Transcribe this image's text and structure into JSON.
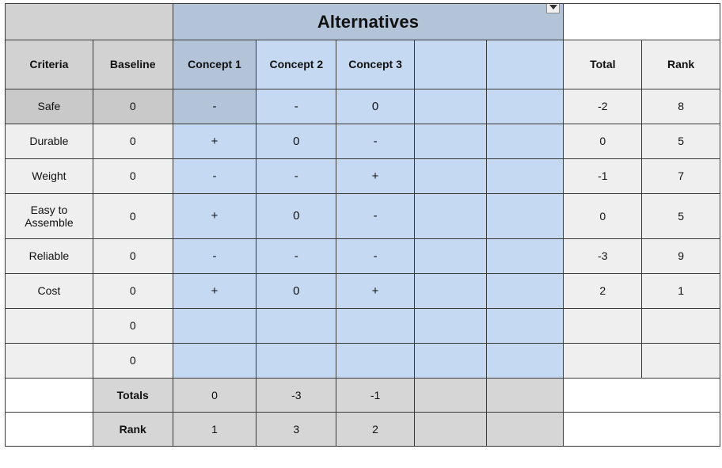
{
  "document": {
    "kind": "pugh-decision-matrix"
  },
  "band": {
    "alternatives_label": "Alternatives",
    "dropdown_icon": "chevron-down-icon"
  },
  "headers": {
    "criteria": "Criteria",
    "baseline": "Baseline",
    "alt1": "Concept 1",
    "alt2": "Concept 2",
    "alt3": "Concept 3",
    "alt4": "",
    "alt5": "",
    "total": "Total",
    "rank": "Rank"
  },
  "rows": [
    {
      "criteria": "Safe",
      "baseline": "0",
      "a1": "-",
      "a2": "-",
      "a3": "0",
      "a4": "",
      "a5": "",
      "total": "-2",
      "rank": "8"
    },
    {
      "criteria": "Durable",
      "baseline": "0",
      "a1": "+",
      "a2": "0",
      "a3": "-",
      "a4": "",
      "a5": "",
      "total": "0",
      "rank": "5"
    },
    {
      "criteria": "Weight",
      "baseline": "0",
      "a1": "-",
      "a2": "-",
      "a3": "+",
      "a4": "",
      "a5": "",
      "total": "-1",
      "rank": "7"
    },
    {
      "criteria": "Easy to Assemble",
      "baseline": "0",
      "a1": "+",
      "a2": "0",
      "a3": "-",
      "a4": "",
      "a5": "",
      "total": "0",
      "rank": "5"
    },
    {
      "criteria": "Reliable",
      "baseline": "0",
      "a1": "-",
      "a2": "-",
      "a3": "-",
      "a4": "",
      "a5": "",
      "total": "-3",
      "rank": "9"
    },
    {
      "criteria": "Cost",
      "baseline": "0",
      "a1": "+",
      "a2": "0",
      "a3": "+",
      "a4": "",
      "a5": "",
      "total": "2",
      "rank": "1"
    },
    {
      "criteria": "",
      "baseline": "0",
      "a1": "",
      "a2": "",
      "a3": "",
      "a4": "",
      "a5": "",
      "total": "",
      "rank": ""
    },
    {
      "criteria": "",
      "baseline": "0",
      "a1": "",
      "a2": "",
      "a3": "",
      "a4": "",
      "a5": "",
      "total": "",
      "rank": ""
    }
  ],
  "footer": {
    "totals_label": "Totals",
    "totals": {
      "a1": "0",
      "a2": "-3",
      "a3": "-1",
      "a4": "",
      "a5": ""
    },
    "rank_label": "Rank",
    "ranks": {
      "a1": "1",
      "a2": "3",
      "a3": "2",
      "a4": "",
      "a5": ""
    }
  },
  "colors": {
    "alt_band": "#b3c4d8",
    "alt_cell": "#c6d9f2",
    "alt_cell_selected": "#b3c4d8",
    "header_grey": "#d2d2d2",
    "body_grey": "#efefef",
    "totals_grey": "#d6d6d6",
    "selected_row_grey": "#c9c9c9",
    "grid_line": "#3a3a3a",
    "blue_grid_line": "#2e4a72"
  }
}
